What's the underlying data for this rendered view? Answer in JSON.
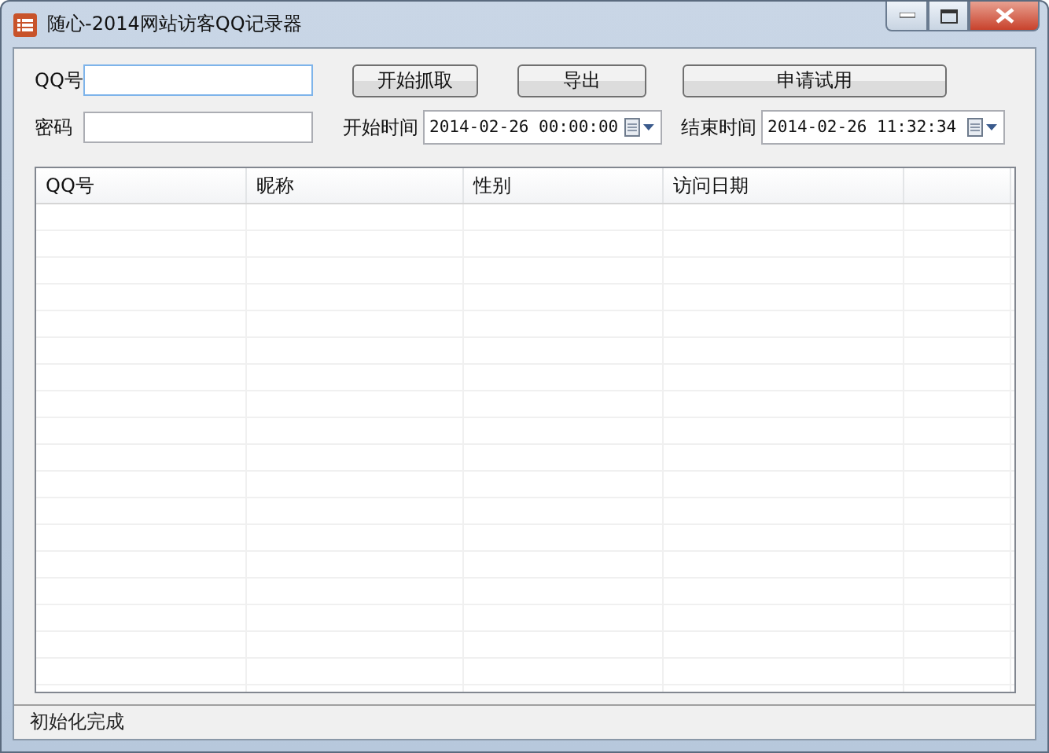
{
  "window": {
    "title": "随心-2014网站访客QQ记录器"
  },
  "form": {
    "qq_label": "QQ号",
    "qq_focused": true,
    "password_label": "密码",
    "start_label": "开始时间",
    "start_value": "2014-02-26 00:00:00",
    "end_label": "结束时间",
    "end_value": "2014-02-26 11:32:34"
  },
  "buttons": [
    "开始抓取",
    "导出",
    "申请试用"
  ],
  "table": {
    "columns": [
      "QQ号",
      "昵称",
      "性别",
      "访问日期"
    ]
  },
  "status_bar": "初始化完成"
}
